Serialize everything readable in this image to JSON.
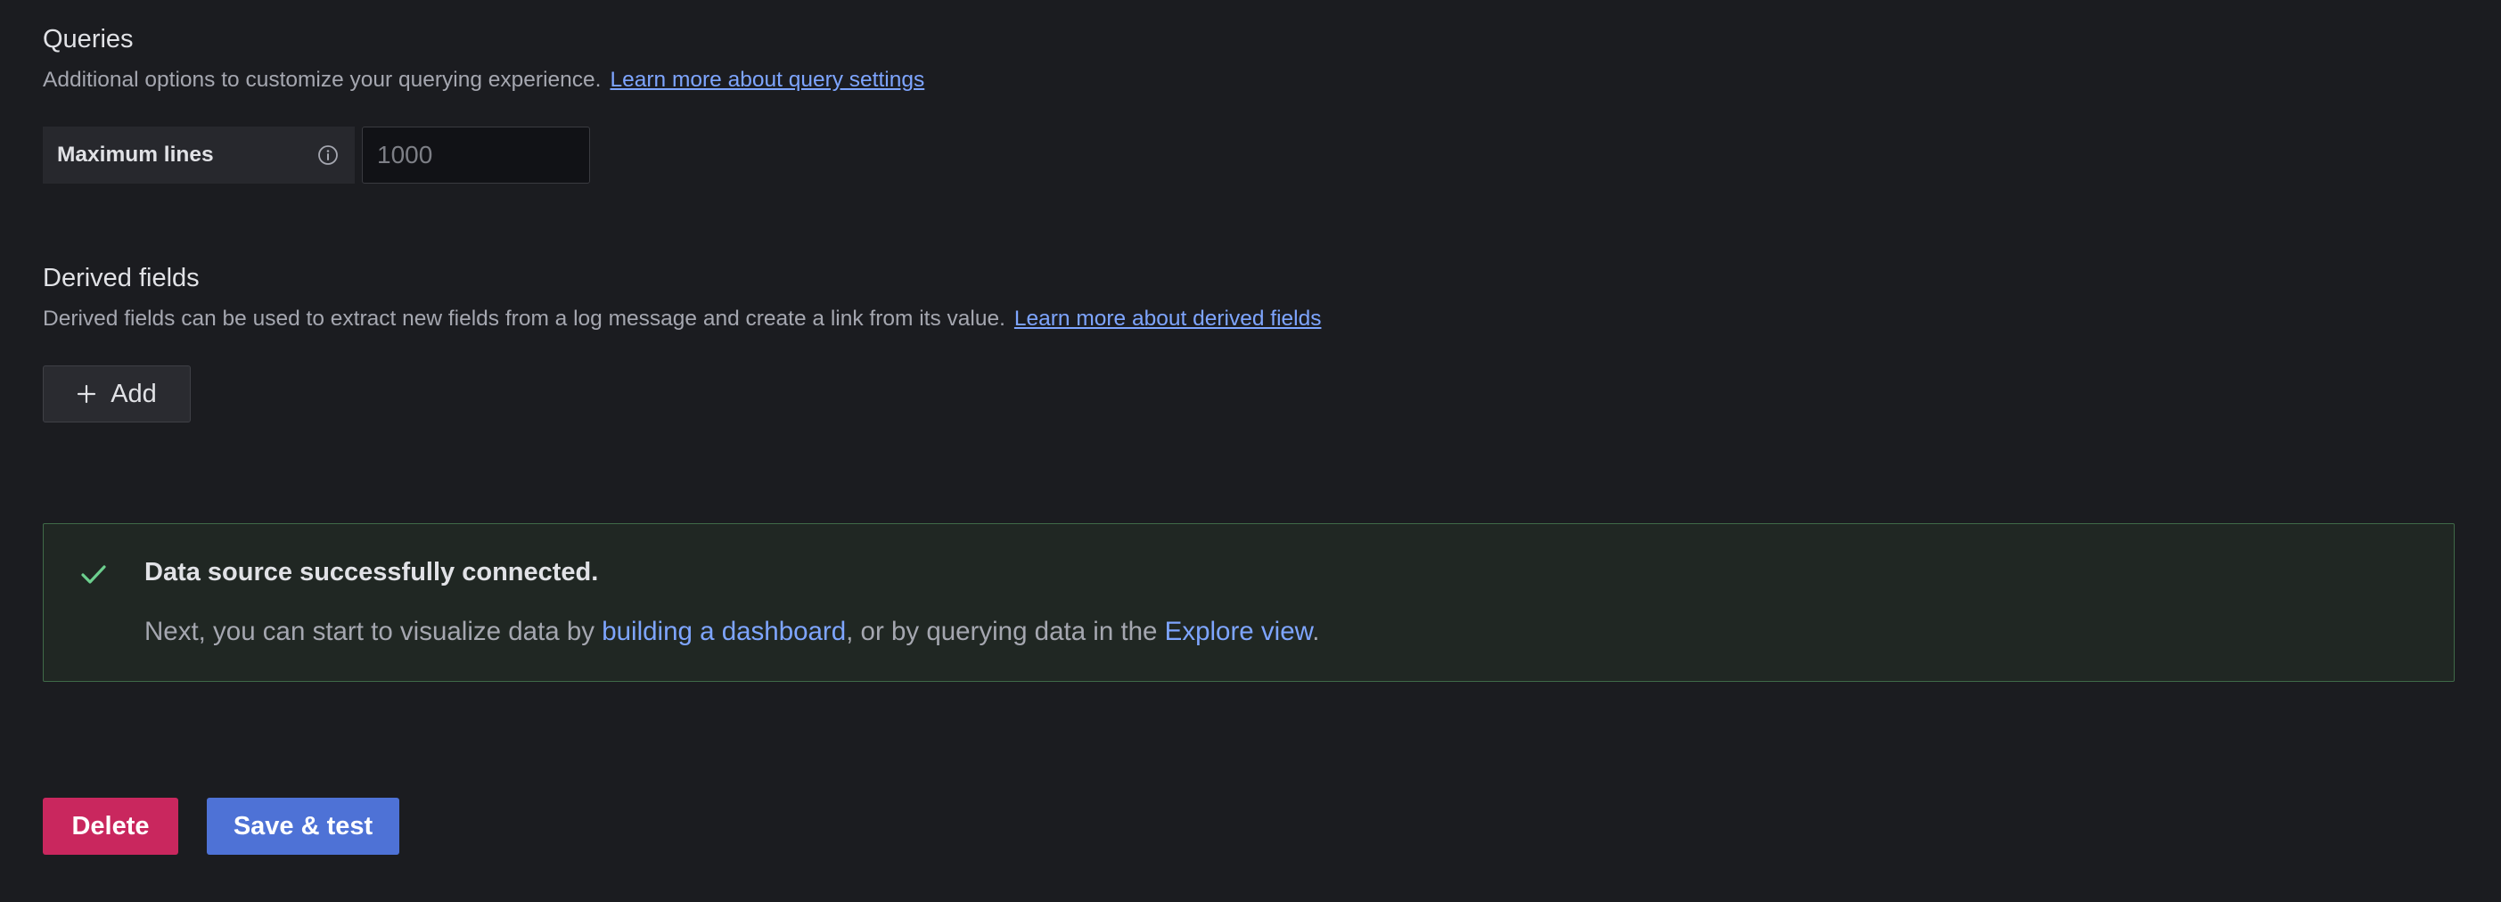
{
  "queries": {
    "title": "Queries",
    "description": "Additional options to customize your querying experience.",
    "learn_more": "Learn more about query settings",
    "max_lines": {
      "label": "Maximum lines",
      "placeholder": "1000",
      "value": ""
    }
  },
  "derived_fields": {
    "title": "Derived fields",
    "description": "Derived fields can be used to extract new fields from a log message and create a link from its value.",
    "learn_more": "Learn more about derived fields",
    "add_label": "Add"
  },
  "alert": {
    "status": "success",
    "title": "Data source successfully connected.",
    "body_prefix": "Next, you can start to visualize data by ",
    "link_dashboard": "building a dashboard",
    "body_middle": ", or by querying data in the ",
    "link_explore": "Explore view",
    "body_suffix": "."
  },
  "actions": {
    "delete_label": "Delete",
    "save_test_label": "Save & test"
  },
  "colors": {
    "background": "#1b1c20",
    "link": "#7ea5ff",
    "success": "#6ccf8e",
    "delete": "#c9275e",
    "primary": "#4e72d6"
  },
  "icons": {
    "info": "info-icon",
    "plus": "plus-icon",
    "check": "check-icon"
  }
}
